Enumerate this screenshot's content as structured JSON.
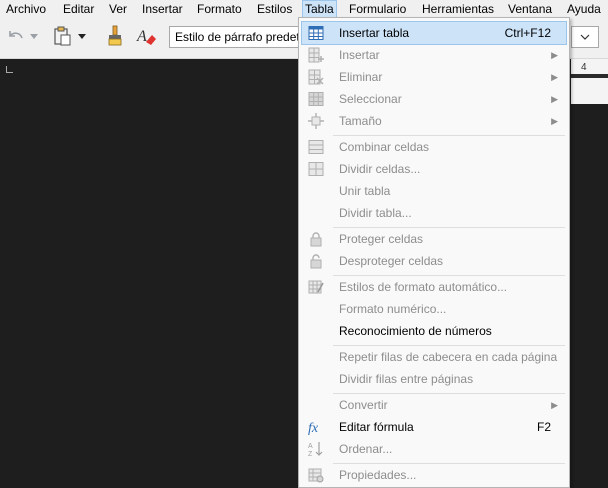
{
  "menubar": [
    "Archivo",
    "Editar",
    "Ver",
    "Insertar",
    "Formato",
    "Estilos",
    "Tabla",
    "Formulario",
    "Herramientas",
    "Ventana",
    "Ayuda"
  ],
  "toolbar": {
    "paragraph_style": "Estilo de párrafo predeterminado"
  },
  "ruler": {
    "number": "4"
  },
  "menu": {
    "items": [
      {
        "label": "Insertar tabla",
        "shortcut": "Ctrl+F12",
        "icon": "table-insert-icon",
        "disabled": false
      },
      {
        "label": "Insertar",
        "icon": "insert-row-icon",
        "disabled": true,
        "submenu": true
      },
      {
        "label": "Eliminar",
        "icon": "delete-row-icon",
        "disabled": true,
        "submenu": true
      },
      {
        "label": "Seleccionar",
        "icon": "select-table-icon",
        "disabled": true,
        "submenu": true
      },
      {
        "label": "Tamaño",
        "icon": "size-icon",
        "disabled": true,
        "submenu": true
      },
      {
        "label": "Combinar celdas",
        "icon": "merge-cells-icon",
        "disabled": true
      },
      {
        "label": "Dividir celdas...",
        "icon": "split-cells-icon",
        "disabled": true
      },
      {
        "label": "Unir tabla",
        "disabled": true
      },
      {
        "label": "Dividir tabla...",
        "disabled": true
      },
      {
        "label": "Proteger celdas",
        "icon": "lock-icon",
        "disabled": true
      },
      {
        "label": "Desproteger celdas",
        "icon": "unlock-icon",
        "disabled": true
      },
      {
        "label": "Estilos de formato automático...",
        "icon": "autoformat-icon",
        "disabled": true
      },
      {
        "label": "Formato numérico...",
        "disabled": true
      },
      {
        "label": "Reconocimiento de números",
        "disabled": false
      },
      {
        "label": "Repetir filas de cabecera en cada página",
        "disabled": true
      },
      {
        "label": "Dividir filas entre páginas",
        "disabled": true
      },
      {
        "label": "Convertir",
        "disabled": true,
        "submenu": true
      },
      {
        "label": "Editar fórmula",
        "shortcut": "F2",
        "icon": "formula-icon",
        "disabled": false
      },
      {
        "label": "Ordenar...",
        "icon": "sort-icon",
        "disabled": true
      },
      {
        "label": "Propiedades...",
        "icon": "table-properties-icon",
        "disabled": true
      }
    ]
  }
}
